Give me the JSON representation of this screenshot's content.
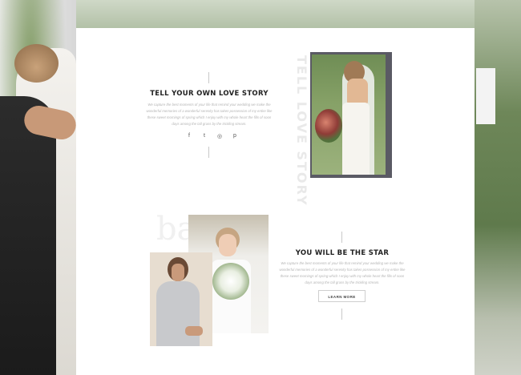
{
  "section1": {
    "title": "TELL YOUR OWN LOVE STORY",
    "body": "We capture the best moments of your life that remind your wedding we make the wonderful memories of a wonderful serenity has taken possession of my entire like these sweet mornings of spring which I enjoy with my whole heart the fills of soon days among the tall grass by the trickling stream.",
    "vertical_text": "TELL LOVE STORY",
    "social_icons": [
      "facebook-icon",
      "twitter-icon",
      "instagram-icon",
      "pinterest-icon"
    ],
    "social_glyphs": [
      "f",
      "t",
      "◎",
      "p"
    ]
  },
  "section2": {
    "title": "YOU WILL BE THE STAR",
    "body": "We capture the best moments of your life that remind your wedding we make the wonderful memories of a wonderful serenity has taken possession of my entire like these sweet mornings of spring which I enjoy with my whole heart the fills of soon days among the tall grass by the trickling stream.",
    "button_label": "LEARN MORE",
    "decor_letters": "ba"
  }
}
